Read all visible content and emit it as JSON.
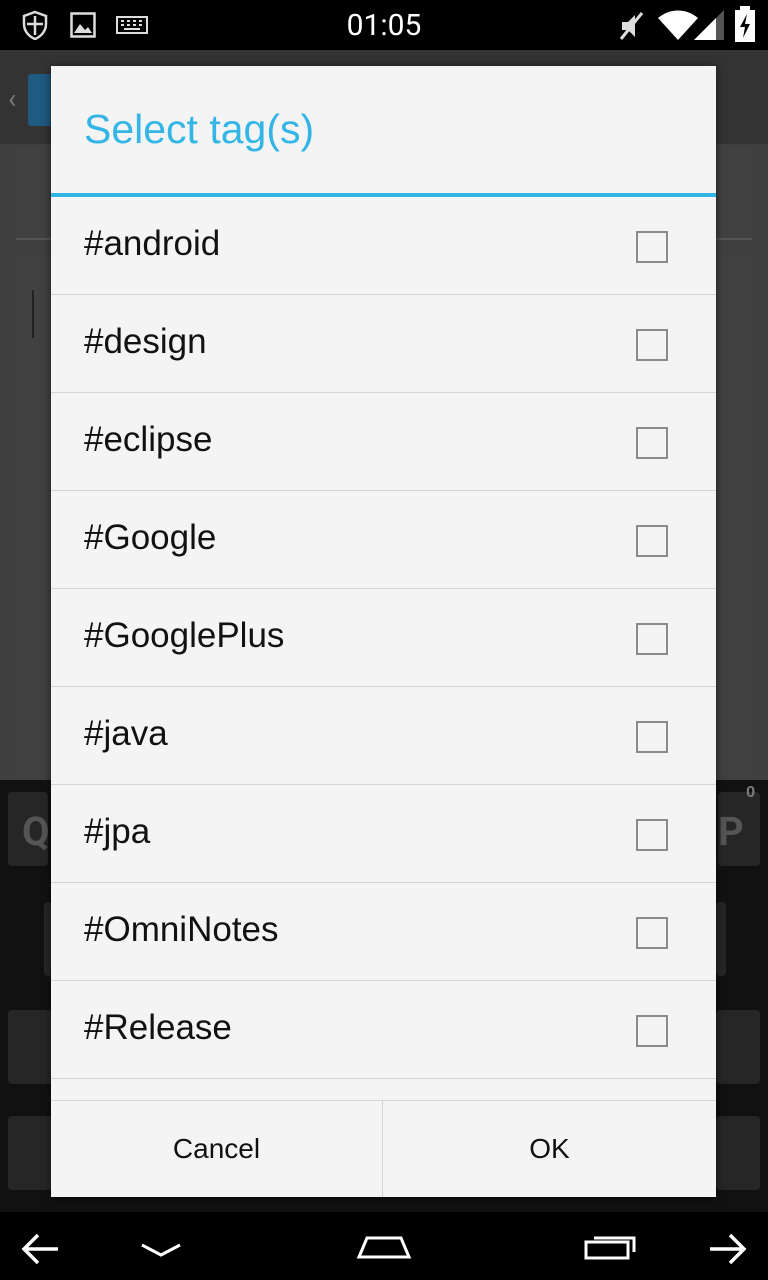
{
  "status_bar": {
    "time": "01:05",
    "icons": [
      "shield-icon",
      "image-icon",
      "keyboard-icon",
      "mute-icon",
      "wifi-icon",
      "signal-icon",
      "battery-charging-icon"
    ]
  },
  "dialog": {
    "title": "Select tag(s)",
    "accent_color": "#33b5e5",
    "tags": [
      {
        "label": "#android",
        "checked": false
      },
      {
        "label": "#design",
        "checked": false
      },
      {
        "label": "#eclipse",
        "checked": false
      },
      {
        "label": "#Google",
        "checked": false
      },
      {
        "label": "#GooglePlus",
        "checked": false
      },
      {
        "label": "#java",
        "checked": false
      },
      {
        "label": "#jpa",
        "checked": false
      },
      {
        "label": "#OmniNotes",
        "checked": false
      },
      {
        "label": "#Release",
        "checked": false
      }
    ],
    "cancel_label": "Cancel",
    "ok_label": "OK"
  },
  "background": {
    "keyboard_letters": {
      "q": "Q",
      "p": "P",
      "count": "0"
    }
  },
  "nav_bar": {
    "icons": [
      "back-arrow-icon",
      "hide-keyboard-icon",
      "home-icon",
      "recents-icon",
      "forward-arrow-icon"
    ]
  }
}
